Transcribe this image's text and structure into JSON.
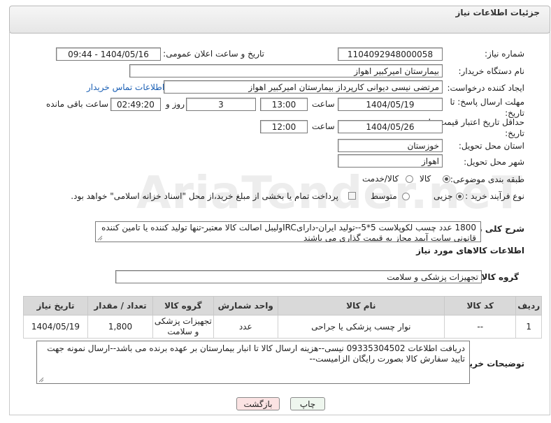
{
  "header": {
    "title": "جزئیات اطلاعات نیاز"
  },
  "watermark": {
    "text": "AriaTender.neT"
  },
  "fields": {
    "need_number_label": "شماره نیاز:",
    "need_number": "1104092948000058",
    "announce_label": "تاریخ و ساعت اعلان عمومی:",
    "announce_value": "1404/05/16 - 09:44",
    "buyer_org_label": "نام دستگاه خریدار:",
    "buyer_org": "بیمارستان امیرکبیر اهواز",
    "creator_label": "ایجاد کننده درخواست:",
    "creator": "مرتضی نیسی دیوانی کارپرداز بیمارستان امیرکبیر اهواز",
    "contact_link": "اطلاعات تماس خریدار",
    "reply_deadline_label": "مهلت ارسال پاسخ: تا تاریخ:",
    "reply_date": "1404/05/19",
    "time_label": "ساعت",
    "reply_time": "13:00",
    "days_value": "3",
    "days_label": "روز و",
    "remaining_time": "02:49:20",
    "remaining_label": "ساعت باقی مانده",
    "price_validity_label": "حداقل تاریخ اعتبار قیمت: تا تاریخ:",
    "price_date": "1404/05/26",
    "price_time": "12:00",
    "province_label": "استان محل تحویل:",
    "province": "خوزستان",
    "city_label": "شهر محل تحویل:",
    "city": "اهواز",
    "category_label": "طبقه بندی موضوعی:",
    "category_options": [
      "کالا",
      "کالا/خدمت"
    ],
    "purchase_type_label": "نوع فرآیند خرید :",
    "purchase_options": [
      "جزیی",
      "متوسط"
    ],
    "payment_note": "پرداخت تمام یا بخشی از مبلغ خرید،از محل \"اسناد خزانه اسلامی\" خواهد بود."
  },
  "description": {
    "label": "شرح کلی نیاز:",
    "text": "1800 عدد چسب لکوپلاست 5*5--تولید ایران-دارایIRCولیبل اصالت کالا معتبر-تنها تولید کننده یا تامین کننده قانونی سایت آیمد مجاز به قیمت گذاری می باشند"
  },
  "goods_section": {
    "title": "اطلاعات کالاهای مورد نیاز",
    "group_label": "گروه کالا:",
    "group_value": "تجهیزات پزشکی و سلامت"
  },
  "table": {
    "headers": [
      "ردیف",
      "کد کالا",
      "نام کالا",
      "واحد شمارش",
      "گروه کالا",
      "تعداد / مقدار",
      "تاریخ نیاز"
    ],
    "rows": [
      [
        "1",
        "--",
        "نوار چسب پزشکی یا جراحی",
        "عدد",
        "تجهیزات پزشکی و سلامت",
        "1,800",
        "1404/05/19"
      ]
    ]
  },
  "buyer_notes": {
    "label": "توضیحات خریدار:",
    "text": "دریافت اطلاعات 09335304502 نیسی--هزینه ارسال کالا تا انبار بیمارستان بر عهده برنده می باشد--ارسال نمونه جهت تایید سفارش کالا بصورت رایگان الزامیست--"
  },
  "buttons": {
    "print": "چاپ",
    "back": "بازگشت"
  },
  "colors": {
    "link": "#1a5fb4",
    "back_button": "#fbe3e3",
    "print_button": "#eef6ee"
  }
}
